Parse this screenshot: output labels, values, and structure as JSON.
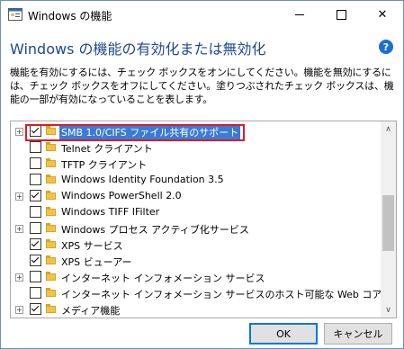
{
  "window": {
    "title": "Windows の機能",
    "minimize": "minimize",
    "maximize": "maximize",
    "close": "✕"
  },
  "heading": "Windows の機能の有効化または無効化",
  "help": "?",
  "description": "機能を有効にするには、チェック ボックスをオンにしてください。機能を無効にするには、チェック ボックスをオフにしてください。塗りつぶされたチェック ボックスは、機能の一部が有効になっていることを表します。",
  "features": [
    {
      "label": "SMB 1.0/CIFS ファイル共有のサポート",
      "checked": true,
      "expandable": true,
      "selected": true,
      "highlighted": true
    },
    {
      "label": "Telnet クライアント",
      "checked": false,
      "expandable": false
    },
    {
      "label": "TFTP クライアント",
      "checked": false,
      "expandable": false
    },
    {
      "label": "Windows Identity Foundation 3.5",
      "checked": false,
      "expandable": false
    },
    {
      "label": "Windows PowerShell 2.0",
      "checked": true,
      "expandable": true
    },
    {
      "label": "Windows TIFF IFilter",
      "checked": false,
      "expandable": false
    },
    {
      "label": "Windows プロセス アクティブ化サービス",
      "checked": false,
      "expandable": true
    },
    {
      "label": "XPS サービス",
      "checked": true,
      "expandable": false
    },
    {
      "label": "XPS ビューアー",
      "checked": true,
      "expandable": false
    },
    {
      "label": "インターネット インフォメーション サービス",
      "checked": false,
      "expandable": true
    },
    {
      "label": "インターネット インフォメーション サービスのホスト可能な Web コア",
      "checked": false,
      "expandable": false
    },
    {
      "label": "メディア機能",
      "checked": true,
      "expandable": true
    }
  ],
  "buttons": {
    "ok": "OK",
    "cancel": "キャンセル"
  },
  "colors": {
    "heading": "#1e4a8c",
    "selection": "#3a7bd5",
    "highlight_border": "#e01b24"
  }
}
